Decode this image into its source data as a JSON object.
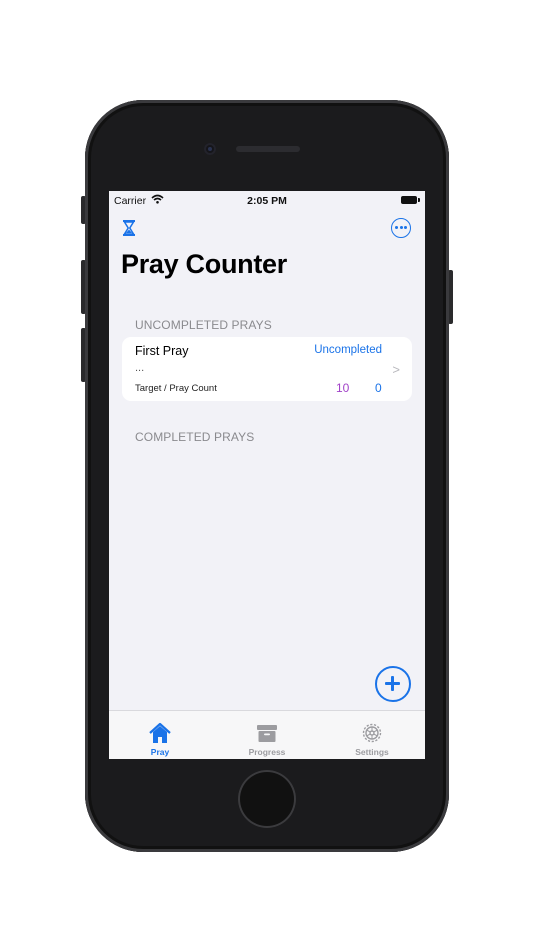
{
  "status_bar": {
    "carrier": "Carrier",
    "time": "2:05 PM"
  },
  "header": {
    "title": "Pray Counter",
    "left_icon": "hourglass-icon",
    "right_icon": "ellipsis-circle-icon"
  },
  "sections": {
    "uncompleted_label": "UNCOMPLETED PRAYS",
    "completed_label": "COMPLETED PRAYS"
  },
  "pray_items": [
    {
      "name": "First Pray",
      "status": "Uncompleted",
      "description": "...",
      "caption": "Target / Pray Count",
      "target": "10",
      "count": "0"
    }
  ],
  "fab": {
    "icon": "plus-circle-icon"
  },
  "tabs": [
    {
      "label": "Pray",
      "icon": "house-icon",
      "active": true
    },
    {
      "label": "Progress",
      "icon": "archive-box-icon",
      "active": false
    },
    {
      "label": "Settings",
      "icon": "gear-icon",
      "active": false
    }
  ],
  "colors": {
    "accent": "#1a73e8",
    "target_color": "#a142c8",
    "background": "#f2f2f7",
    "inactive_tab": "#9c9ca0"
  }
}
